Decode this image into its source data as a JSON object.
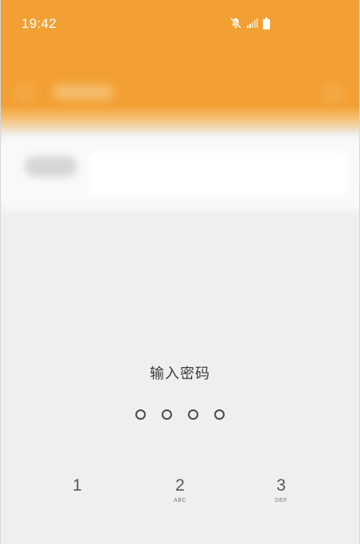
{
  "status_bar": {
    "time": "19:42",
    "icons": [
      "mute-icon",
      "signal-icon",
      "battery-icon"
    ]
  },
  "colors": {
    "header": "#f2a033",
    "background": "#efefef",
    "text": "#3a3a3a"
  },
  "lock": {
    "prompt": "输入密码",
    "pin_length": 4
  },
  "keypad": {
    "keys": [
      {
        "digit": "1",
        "letters": ""
      },
      {
        "digit": "2",
        "letters": "ABC"
      },
      {
        "digit": "3",
        "letters": "DEF"
      }
    ]
  }
}
